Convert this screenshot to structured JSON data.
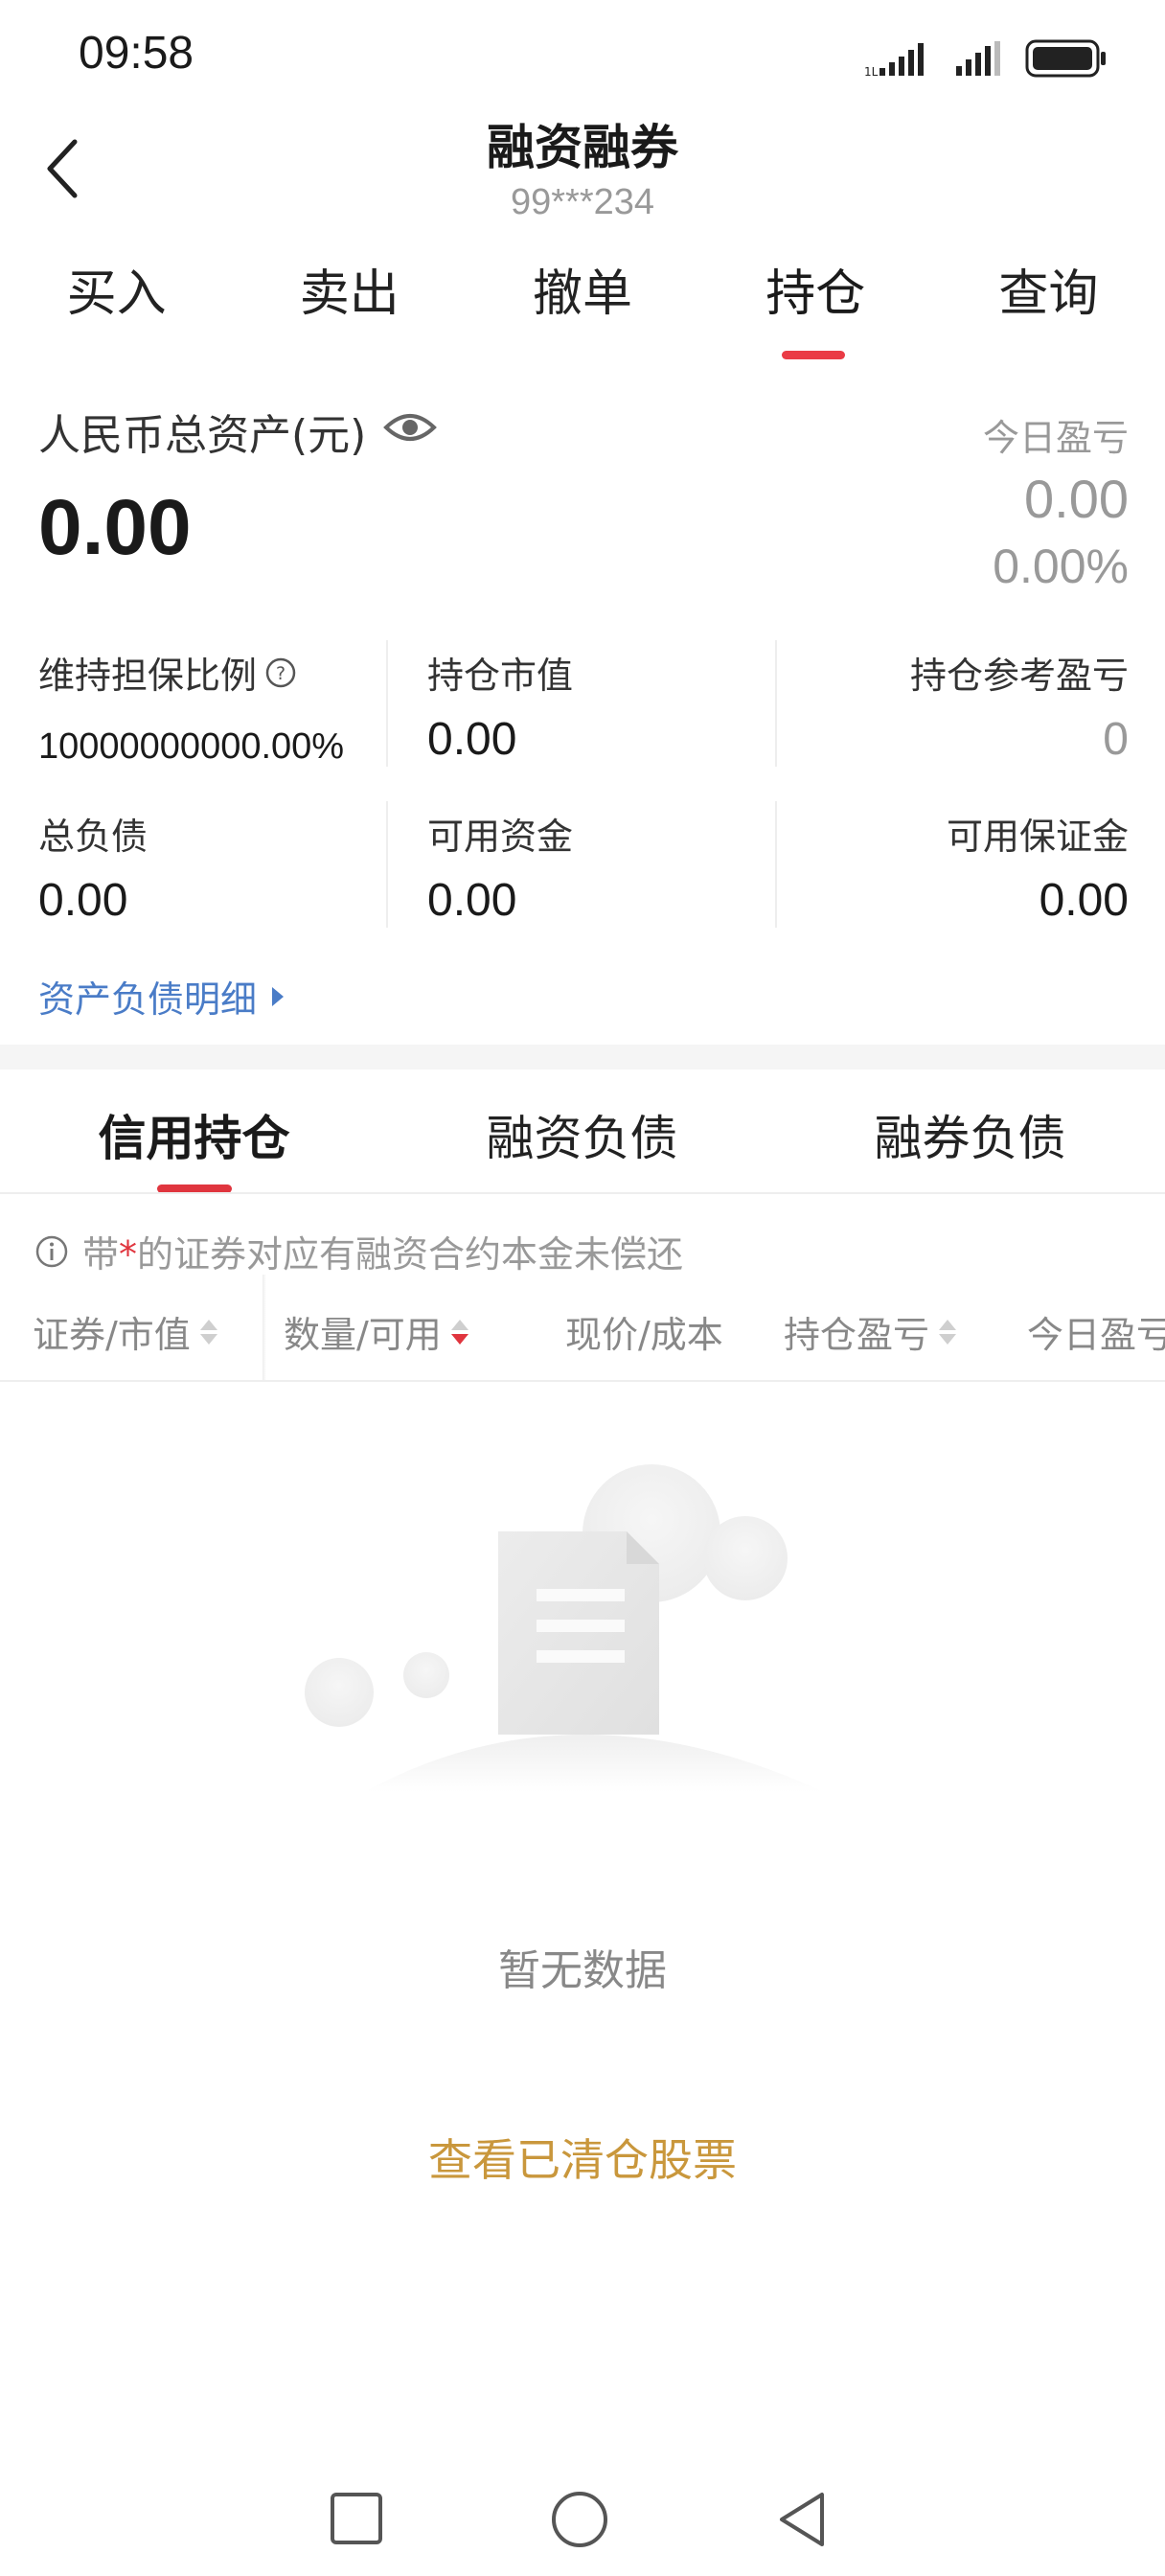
{
  "status_bar": {
    "time": "09:58",
    "icons": [
      "signal-icon",
      "signal-icon",
      "battery-icon"
    ]
  },
  "header": {
    "title": "融资融券",
    "account": "99***234",
    "back_icon": "chevron-left-icon"
  },
  "trade_tabs": {
    "active": "持仓",
    "items": [
      "买入",
      "卖出",
      "撤单",
      "持仓",
      "查询"
    ]
  },
  "summary": {
    "total_assets_label": "人民币总资产(元)",
    "total_assets_value": "0.00",
    "today_pnl_label": "今日盈亏",
    "today_pnl_value": "0.00",
    "today_pnl_pct": "0.00%",
    "metrics": [
      {
        "label": "维持担保比例",
        "value": "10000000000.00%"
      },
      {
        "label": "持仓市值",
        "value": "0.00"
      },
      {
        "label": "持仓参考盈亏",
        "value": "0"
      },
      {
        "label": "总负债",
        "value": "0.00"
      },
      {
        "label": "可用资金",
        "value": "0.00"
      },
      {
        "label": "可用保证金",
        "value": "0.00"
      }
    ],
    "detail_link": "资产负债明细"
  },
  "sub_tabs": {
    "active": "信用持仓",
    "items": [
      "信用持仓",
      "融资负债",
      "融券负债"
    ]
  },
  "notice": {
    "prefix": "带",
    "star": "*",
    "suffix": "的证券对应有融资合约本金未偿还"
  },
  "columns": [
    "证券/市值",
    "数量/可用",
    "现价/成本",
    "持仓盈亏",
    "今日盈亏"
  ],
  "empty": {
    "text": "暂无数据",
    "link": "查看已清仓股票"
  },
  "colors": {
    "accent_red": "#e0353e",
    "link_blue": "#4a7cc7",
    "link_gold": "#c9973c"
  }
}
